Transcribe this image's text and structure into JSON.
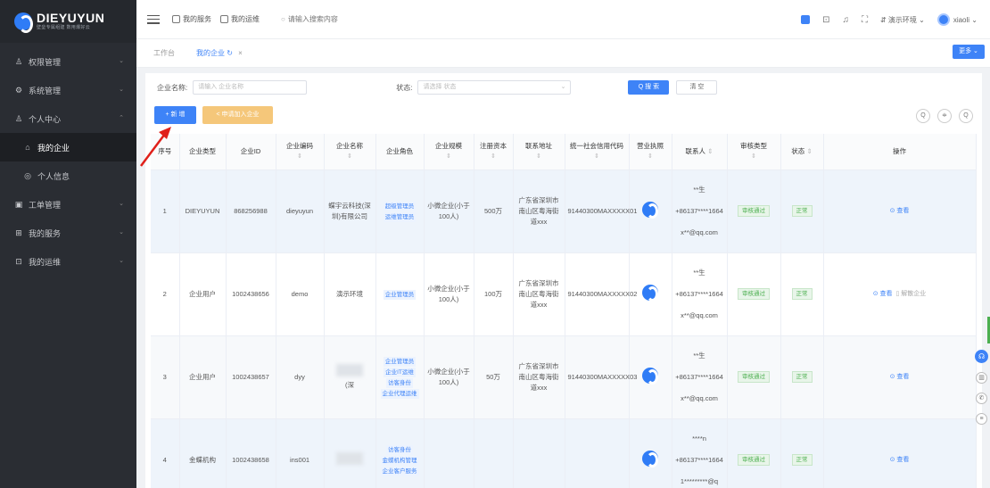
{
  "sidebar": {
    "brand": "DIEYUYUN",
    "slogan": "壁垒专属组建 数用爆好云",
    "items": [
      {
        "label": "权限管理",
        "icon": "user-icon",
        "arrow": "⌄"
      },
      {
        "label": "系统管理",
        "icon": "gear-icon",
        "arrow": "⌄"
      },
      {
        "label": "个人中心",
        "icon": "user-icon",
        "arrow": "⌃"
      },
      {
        "label": "我的企业",
        "icon": "home-icon",
        "active": true
      },
      {
        "label": "个人信息",
        "icon": "circle-icon"
      },
      {
        "label": "工单管理",
        "icon": "ticket-icon",
        "arrow": "⌄"
      },
      {
        "label": "我的服务",
        "icon": "grid-icon",
        "arrow": "⌄"
      },
      {
        "label": "我的运维",
        "icon": "box-icon",
        "arrow": "⌄"
      }
    ]
  },
  "header": {
    "nav1": "我的服务",
    "nav2": "我的运维",
    "search_placeholder": "请输入搜索内容",
    "env": "演示环境",
    "user": "xiaoli"
  },
  "tabs": {
    "items": [
      "工作台",
      "我的企业"
    ],
    "more": "更多"
  },
  "filter": {
    "name_label": "企业名称:",
    "name_placeholder": "请输入 企业名称",
    "status_label": "状态:",
    "status_placeholder": "请选择 状态",
    "search": "Q 搜 索",
    "clear": "清 空"
  },
  "actions": {
    "add": "+ 新 增",
    "join": "< 申请加入企业"
  },
  "table": {
    "headers": [
      "序号",
      "企业类型",
      "企业ID",
      "企业编码",
      "企业名称",
      "企业角色",
      "企业规模",
      "注册资本",
      "联系地址",
      "统一社会信用代码",
      "营业执照",
      "联系人",
      "审核类型",
      "状态",
      "操作"
    ],
    "rows": [
      {
        "no": "1",
        "type": "DIEYUYUN",
        "id": "868256988",
        "code": "dieyuyun",
        "name": "蝶宇云科技(深圳)有限公司",
        "roles": [
          "超级管理员",
          "运维管理员"
        ],
        "scale": "小微企业(小于100人)",
        "capital": "500万",
        "addr": "广东省深圳市南山区粤海街道xxx",
        "credit": "91440300MAXXXXX01",
        "contact": [
          "**生",
          "+86137****1664",
          "x**@qq.com"
        ],
        "audit": "审核通过",
        "status": "正常",
        "op": "查看",
        "op2": ""
      },
      {
        "no": "2",
        "type": "企业用户",
        "id": "1002438656",
        "code": "demo",
        "name": "演示环境",
        "roles": [
          "企业管理员"
        ],
        "scale": "小微企业(小于100人)",
        "capital": "100万",
        "addr": "广东省深圳市南山区粤海街道xxx",
        "credit": "91440300MAXXXXX02",
        "contact": [
          "**生",
          "+86137****1664",
          "x**@qq.com"
        ],
        "audit": "审核通过",
        "status": "正常",
        "op": "查看",
        "op2": "解散企业"
      },
      {
        "no": "3",
        "type": "企业用户",
        "id": "1002438657",
        "code": "dyy",
        "name": "(深",
        "roles": [
          "企业管理员",
          "企业IT运维",
          "访客身份",
          "企业代理运维"
        ],
        "scale": "小微企业(小于100人)",
        "capital": "50万",
        "addr": "广东省深圳市南山区粤海街道xxx",
        "credit": "91440300MAXXXXX03",
        "contact": [
          "**生",
          "+86137****1664",
          "x**@qq.com"
        ],
        "audit": "审核通过",
        "status": "正常",
        "op": "查看",
        "op2": ""
      },
      {
        "no": "4",
        "type": "金蝶机构",
        "id": "1002438658",
        "code": "ins001",
        "name": "",
        "roles": [
          "访客身份",
          "金蝶机构管理",
          "企业客户服务"
        ],
        "scale": "",
        "capital": "",
        "addr": "",
        "credit": "",
        "contact": [
          "****n",
          "+86137****1664",
          "1*********@q"
        ],
        "audit": "审核通过",
        "status": "正常",
        "op": "查看",
        "op2": ""
      }
    ]
  }
}
